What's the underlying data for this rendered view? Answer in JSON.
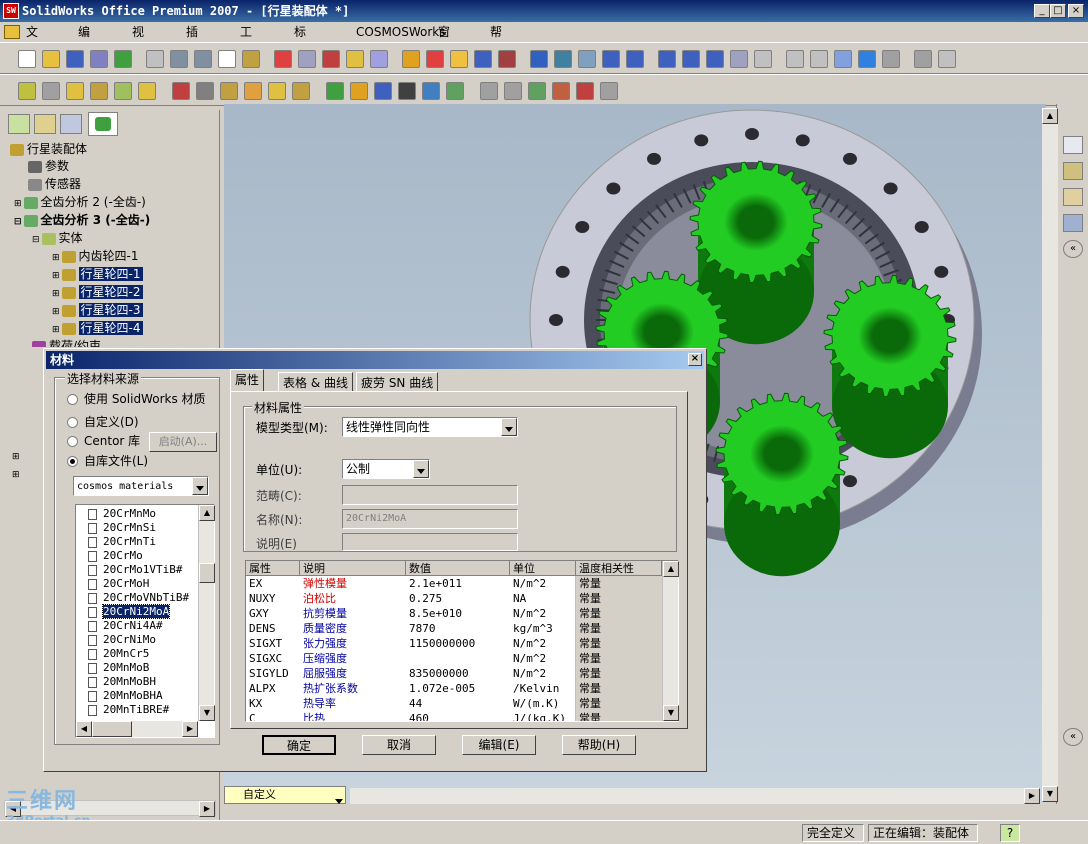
{
  "window": {
    "title": "SolidWorks Office Premium 2007 - [行星装配体 *]"
  },
  "menu": [
    "文件(F)",
    "编辑(E)",
    "视图(V)",
    "插入(I)",
    "工具(T)",
    "标准件库",
    "COSMOSWorks",
    "窗口(W)",
    "帮助(H)"
  ],
  "tree": {
    "root": "行星装配体",
    "items": [
      {
        "label": "参数"
      },
      {
        "label": "传感器"
      },
      {
        "label": "全齿分析 2 (-全齿-)"
      },
      {
        "label": "全齿分析 3 (-全齿-)"
      },
      {
        "label": "实体"
      },
      {
        "label": "内齿轮四-1"
      },
      {
        "label": "行星轮四-1"
      },
      {
        "label": "行星轮四-2"
      },
      {
        "label": "行星轮四-3"
      },
      {
        "label": "行星轮四-4"
      },
      {
        "label": "载荷/约束"
      }
    ]
  },
  "dialog": {
    "title": "材料",
    "source_group": "选择材料来源",
    "radios": [
      {
        "label": "使用 SolidWorks 材质",
        "checked": false
      },
      {
        "label": "自定义(D)",
        "checked": false
      },
      {
        "label": "Centor 库",
        "checked": false
      },
      {
        "label": "自库文件(L)",
        "checked": true
      }
    ],
    "launch_button": "启动(A)...",
    "library_select": "cosmos materials",
    "materials": [
      "20CrMnMo",
      "20CrMnSi",
      "20CrMnTi",
      "20CrMo",
      "20CrMo1VTiB#",
      "20CrMoH",
      "20CrMoVNbTiB#",
      "20CrNi2MoA",
      "20CrNi4A#",
      "20CrNiMo",
      "20MnCr5",
      "20MnMoB",
      "20MnMoBH",
      "20MnMoBHA",
      "20MnTiBRE#"
    ],
    "selected_material": "20CrNi2MoA",
    "tabs": [
      "属性",
      "表格 & 曲线",
      "疲劳 SN 曲线"
    ],
    "props_group": "材料属性",
    "model_type_label": "模型类型(M):",
    "model_type_value": "线性弹性同向性",
    "unit_label": "单位(U):",
    "unit_value": "公制",
    "category_label": "范畴(C):",
    "name_label": "名称(N):",
    "name_value": "20CrNi2MoA",
    "desc_label": "说明(E)",
    "table_headers": [
      "属性",
      "说明",
      "数值",
      "单位",
      "温度相关性"
    ],
    "table_rows": [
      {
        "prop": "EX",
        "desc": "弹性模量",
        "value": "2.1e+011",
        "unit": "N/m^2",
        "temp": "常量",
        "red": true
      },
      {
        "prop": "NUXY",
        "desc": "泊松比",
        "value": "0.275",
        "unit": "NA",
        "temp": "常量",
        "red": true
      },
      {
        "prop": "GXY",
        "desc": "抗剪模量",
        "value": "8.5e+010",
        "unit": "N/m^2",
        "temp": "常量",
        "red": false
      },
      {
        "prop": "DENS",
        "desc": "质量密度",
        "value": "7870",
        "unit": "kg/m^3",
        "temp": "常量",
        "red": false
      },
      {
        "prop": "SIGXT",
        "desc": "张力强度",
        "value": "1150000000",
        "unit": "N/m^2",
        "temp": "常量",
        "red": false
      },
      {
        "prop": "SIGXC",
        "desc": "压缩强度",
        "value": "",
        "unit": "N/m^2",
        "temp": "常量",
        "red": false
      },
      {
        "prop": "SIGYLD",
        "desc": "屈服强度",
        "value": "835000000",
        "unit": "N/m^2",
        "temp": "常量",
        "red": false
      },
      {
        "prop": "ALPX",
        "desc": "热扩张系数",
        "value": "1.072e-005",
        "unit": "/Kelvin",
        "temp": "常量",
        "red": false
      },
      {
        "prop": "KX",
        "desc": "热导率",
        "value": "44",
        "unit": "W/(m.K)",
        "temp": "常量",
        "red": false
      },
      {
        "prop": "C",
        "desc": "比热",
        "value": "460",
        "unit": "J/(kg.K)",
        "temp": "常量",
        "red": false
      }
    ],
    "buttons": {
      "ok": "确定",
      "cancel": "取消",
      "edit": "编辑(E)",
      "help": "帮助(H)"
    }
  },
  "bottom": {
    "config": "自定义",
    "watermark": "三维网",
    "watermark_url": "3dPortal.cn"
  },
  "status": {
    "fully_defined": "完全定义",
    "editing": "正在编辑：装配体",
    "help": "?"
  },
  "colors": {
    "gear": "#22cc22",
    "ring": "#c8cad8",
    "selection": "#0a246a"
  }
}
